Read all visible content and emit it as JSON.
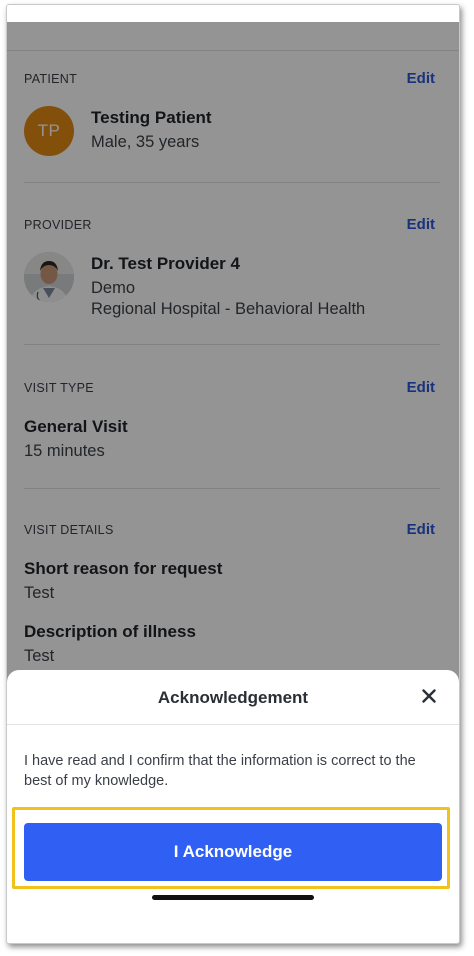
{
  "patient": {
    "section_label": "PATIENT",
    "edit_label": "Edit",
    "initials": "TP",
    "name": "Testing Patient",
    "details": "Male, 35 years"
  },
  "provider": {
    "section_label": "PROVIDER",
    "edit_label": "Edit",
    "name": "Dr. Test Provider 4",
    "line1": "Demo",
    "line2": "Regional Hospital - Behavioral Health"
  },
  "visit_type": {
    "section_label": "VISIT TYPE",
    "edit_label": "Edit",
    "name": "General Visit",
    "duration": "15 minutes"
  },
  "visit_details": {
    "section_label": "VISIT DETAILS",
    "edit_label": "Edit",
    "reason_label": "Short reason for request",
    "reason_value": "Test",
    "illness_label": "Description of illness",
    "illness_value": "Test"
  },
  "sheet": {
    "title": "Acknowledgement",
    "close_icon": "close-icon",
    "body": "I have read and I confirm that the information is correct to the best of my knowledge.",
    "button_label": "I Acknowledge"
  },
  "colors": {
    "accent": "#2f5ff3",
    "link": "#2b56d8",
    "avatar": "#e08a14",
    "highlight": "#f1c21b"
  }
}
